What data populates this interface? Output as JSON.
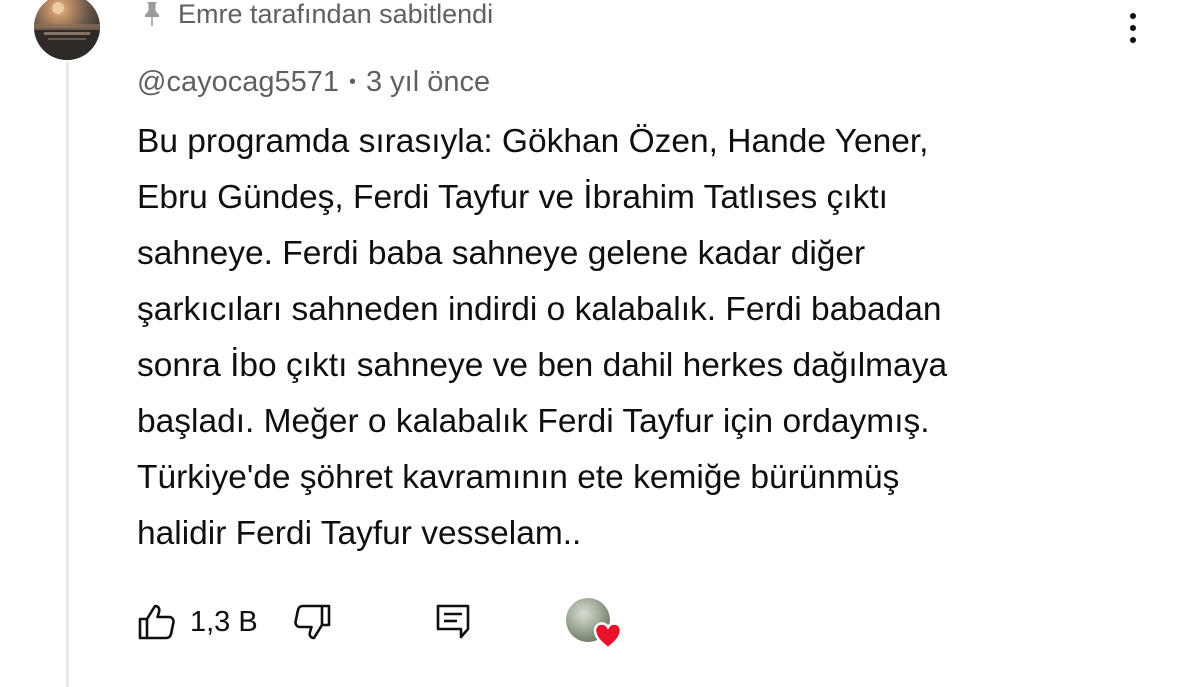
{
  "pinned": {
    "label": "Emre tarafından sabitlendi",
    "icon": "pin-icon"
  },
  "comment": {
    "author": "@cayocag5571",
    "separator": "•",
    "time": "3 yıl önce",
    "lines": [
      "Bu programda sırasıyla: Gökhan Özen, Hande Yener,",
      "Ebru Gündeş, Ferdi Tayfur ve İbrahim Tatlıses çıktı",
      "sahneye. Ferdi baba sahneye gelene kadar diğer",
      "şarkıcıları sahneden indirdi o kalabalık. Ferdi babadan",
      "sonra İbo çıktı sahneye ve ben dahil herkes dağılmaya",
      "başladı. Meğer o kalabalık Ferdi Tayfur için ordaymış.",
      "Türkiye'de şöhret kavramının ete kemiğe bürünmüş",
      "halidir Ferdi Tayfur vesselam.."
    ]
  },
  "actions": {
    "like_count": "1,3 B",
    "icons": [
      "thumbs-up-icon",
      "thumbs-down-icon",
      "reply-comment-icon",
      "more-vertical-icon"
    ]
  },
  "colors": {
    "text": "#0f0f0f",
    "secondary_text": "#606060",
    "heart": "#e8132b",
    "thread_line": "#e9e9e9"
  }
}
